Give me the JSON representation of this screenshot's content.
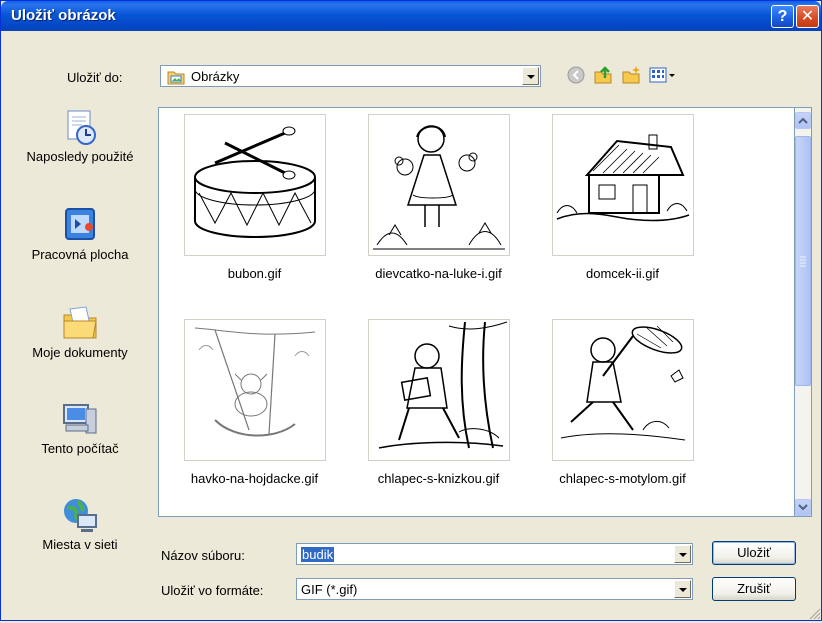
{
  "window": {
    "title": "Uložiť obrázok",
    "help_glyph": "?",
    "close_glyph": "✕"
  },
  "save_in": {
    "label": "Uložiť do:",
    "label_underline_char": "d",
    "value": "Obrázky",
    "icons": [
      "back-icon",
      "up-folder-icon",
      "new-folder-icon",
      "view-menu-icon"
    ]
  },
  "places": [
    {
      "label": "Naposledy použité",
      "icon": "recent-icon"
    },
    {
      "label": "Pracovná plocha",
      "icon": "desktop-icon"
    },
    {
      "label": "Moje dokumenty",
      "icon": "my-documents-icon"
    },
    {
      "label": "Tento počítač",
      "icon": "my-computer-icon"
    },
    {
      "label": "Miesta v sieti",
      "icon": "network-places-icon"
    }
  ],
  "files": [
    {
      "name": "bubon.gif"
    },
    {
      "name": "dievcatko-na-luke-i.gif"
    },
    {
      "name": "domcek-ii.gif"
    },
    {
      "name": "havko-na-hojdacke.gif"
    },
    {
      "name": "chlapec-s-knizkou.gif"
    },
    {
      "name": "chlapec-s-motylom.gif"
    }
  ],
  "filename": {
    "label": "Názov súboru:",
    "value": "budik"
  },
  "format": {
    "label": "Uložiť vo formáte:",
    "value": "GIF (*.gif)"
  },
  "buttons": {
    "save": "Uložiť",
    "cancel": "Zrušiť"
  },
  "colors": {
    "titlebar": "#0448C8",
    "face": "#ECE9D8",
    "selection": "#316AC5"
  }
}
